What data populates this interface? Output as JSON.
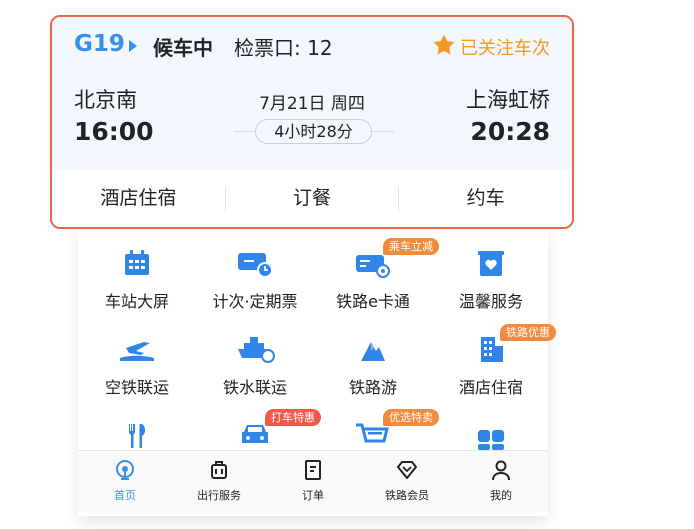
{
  "ticket": {
    "train_number": "G19",
    "status": "候车中",
    "gate": "检票口: 12",
    "followed_label": "已关注车次",
    "from_station": "北京南",
    "from_time": "16:00",
    "to_station": "上海虹桥",
    "to_time": "20:28",
    "date": "7月21日 周四",
    "duration": "4小时28分",
    "services": [
      "酒店住宿",
      "订餐",
      "约车"
    ]
  },
  "grid": {
    "items": [
      {
        "label": "车站大屏",
        "icon": "station-screen-icon"
      },
      {
        "label": "计次·定期票",
        "icon": "ticket-clock-icon"
      },
      {
        "label": "铁路e卡通",
        "icon": "ecard-icon",
        "badge": "乘车立减"
      },
      {
        "label": "温馨服务",
        "icon": "heart-service-icon"
      },
      {
        "label": "空铁联运",
        "icon": "plane-rail-icon"
      },
      {
        "label": "铁水联运",
        "icon": "ship-rail-icon"
      },
      {
        "label": "铁路游",
        "icon": "mountain-icon"
      },
      {
        "label": "酒店住宿",
        "icon": "hotel-icon",
        "badge": "铁路优惠"
      },
      {
        "label": "",
        "icon": "fork-knife-icon"
      },
      {
        "label": "",
        "icon": "car-icon",
        "badge": "打车特惠"
      },
      {
        "label": "",
        "icon": "cart-icon",
        "badge": "优选特卖"
      },
      {
        "label": "",
        "icon": "apps-icon"
      }
    ]
  },
  "nav": {
    "items": [
      {
        "label": "首页",
        "icon": "home-icon",
        "active": true
      },
      {
        "label": "出行服务",
        "icon": "luggage-icon"
      },
      {
        "label": "订单",
        "icon": "order-icon"
      },
      {
        "label": "铁路会员",
        "icon": "diamond-icon"
      },
      {
        "label": "我的",
        "icon": "user-icon"
      }
    ]
  },
  "colors": {
    "accent": "#3a8ee6",
    "highlight": "#e8674a",
    "star": "#f39a1c"
  }
}
